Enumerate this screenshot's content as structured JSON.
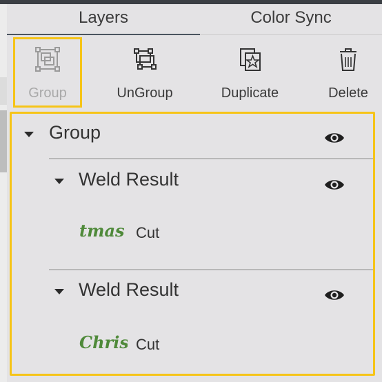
{
  "tabs": [
    {
      "label": "Layers",
      "active": true
    },
    {
      "label": "Color Sync",
      "active": false
    }
  ],
  "toolbar": {
    "group": {
      "label": "Group",
      "icon": "group-icon",
      "enabled": false
    },
    "ungroup": {
      "label": "UnGroup",
      "icon": "ungroup-icon"
    },
    "duplicate": {
      "label": "Duplicate",
      "icon": "duplicate-icon"
    },
    "delete": {
      "label": "Delete",
      "icon": "trash-icon"
    }
  },
  "layers": {
    "group": {
      "title": "Group",
      "visible": true
    },
    "items": [
      {
        "title": "Weld Result",
        "visible": true,
        "thumb_text": "tmas",
        "action": "Cut"
      },
      {
        "title": "Weld Result",
        "visible": true,
        "thumb_text": "Chris",
        "action": "Cut"
      }
    ]
  },
  "colors": {
    "highlight": "#f6c417",
    "thumb_green": "#4f8a3a",
    "panel_bg": "#e4e3e5"
  }
}
